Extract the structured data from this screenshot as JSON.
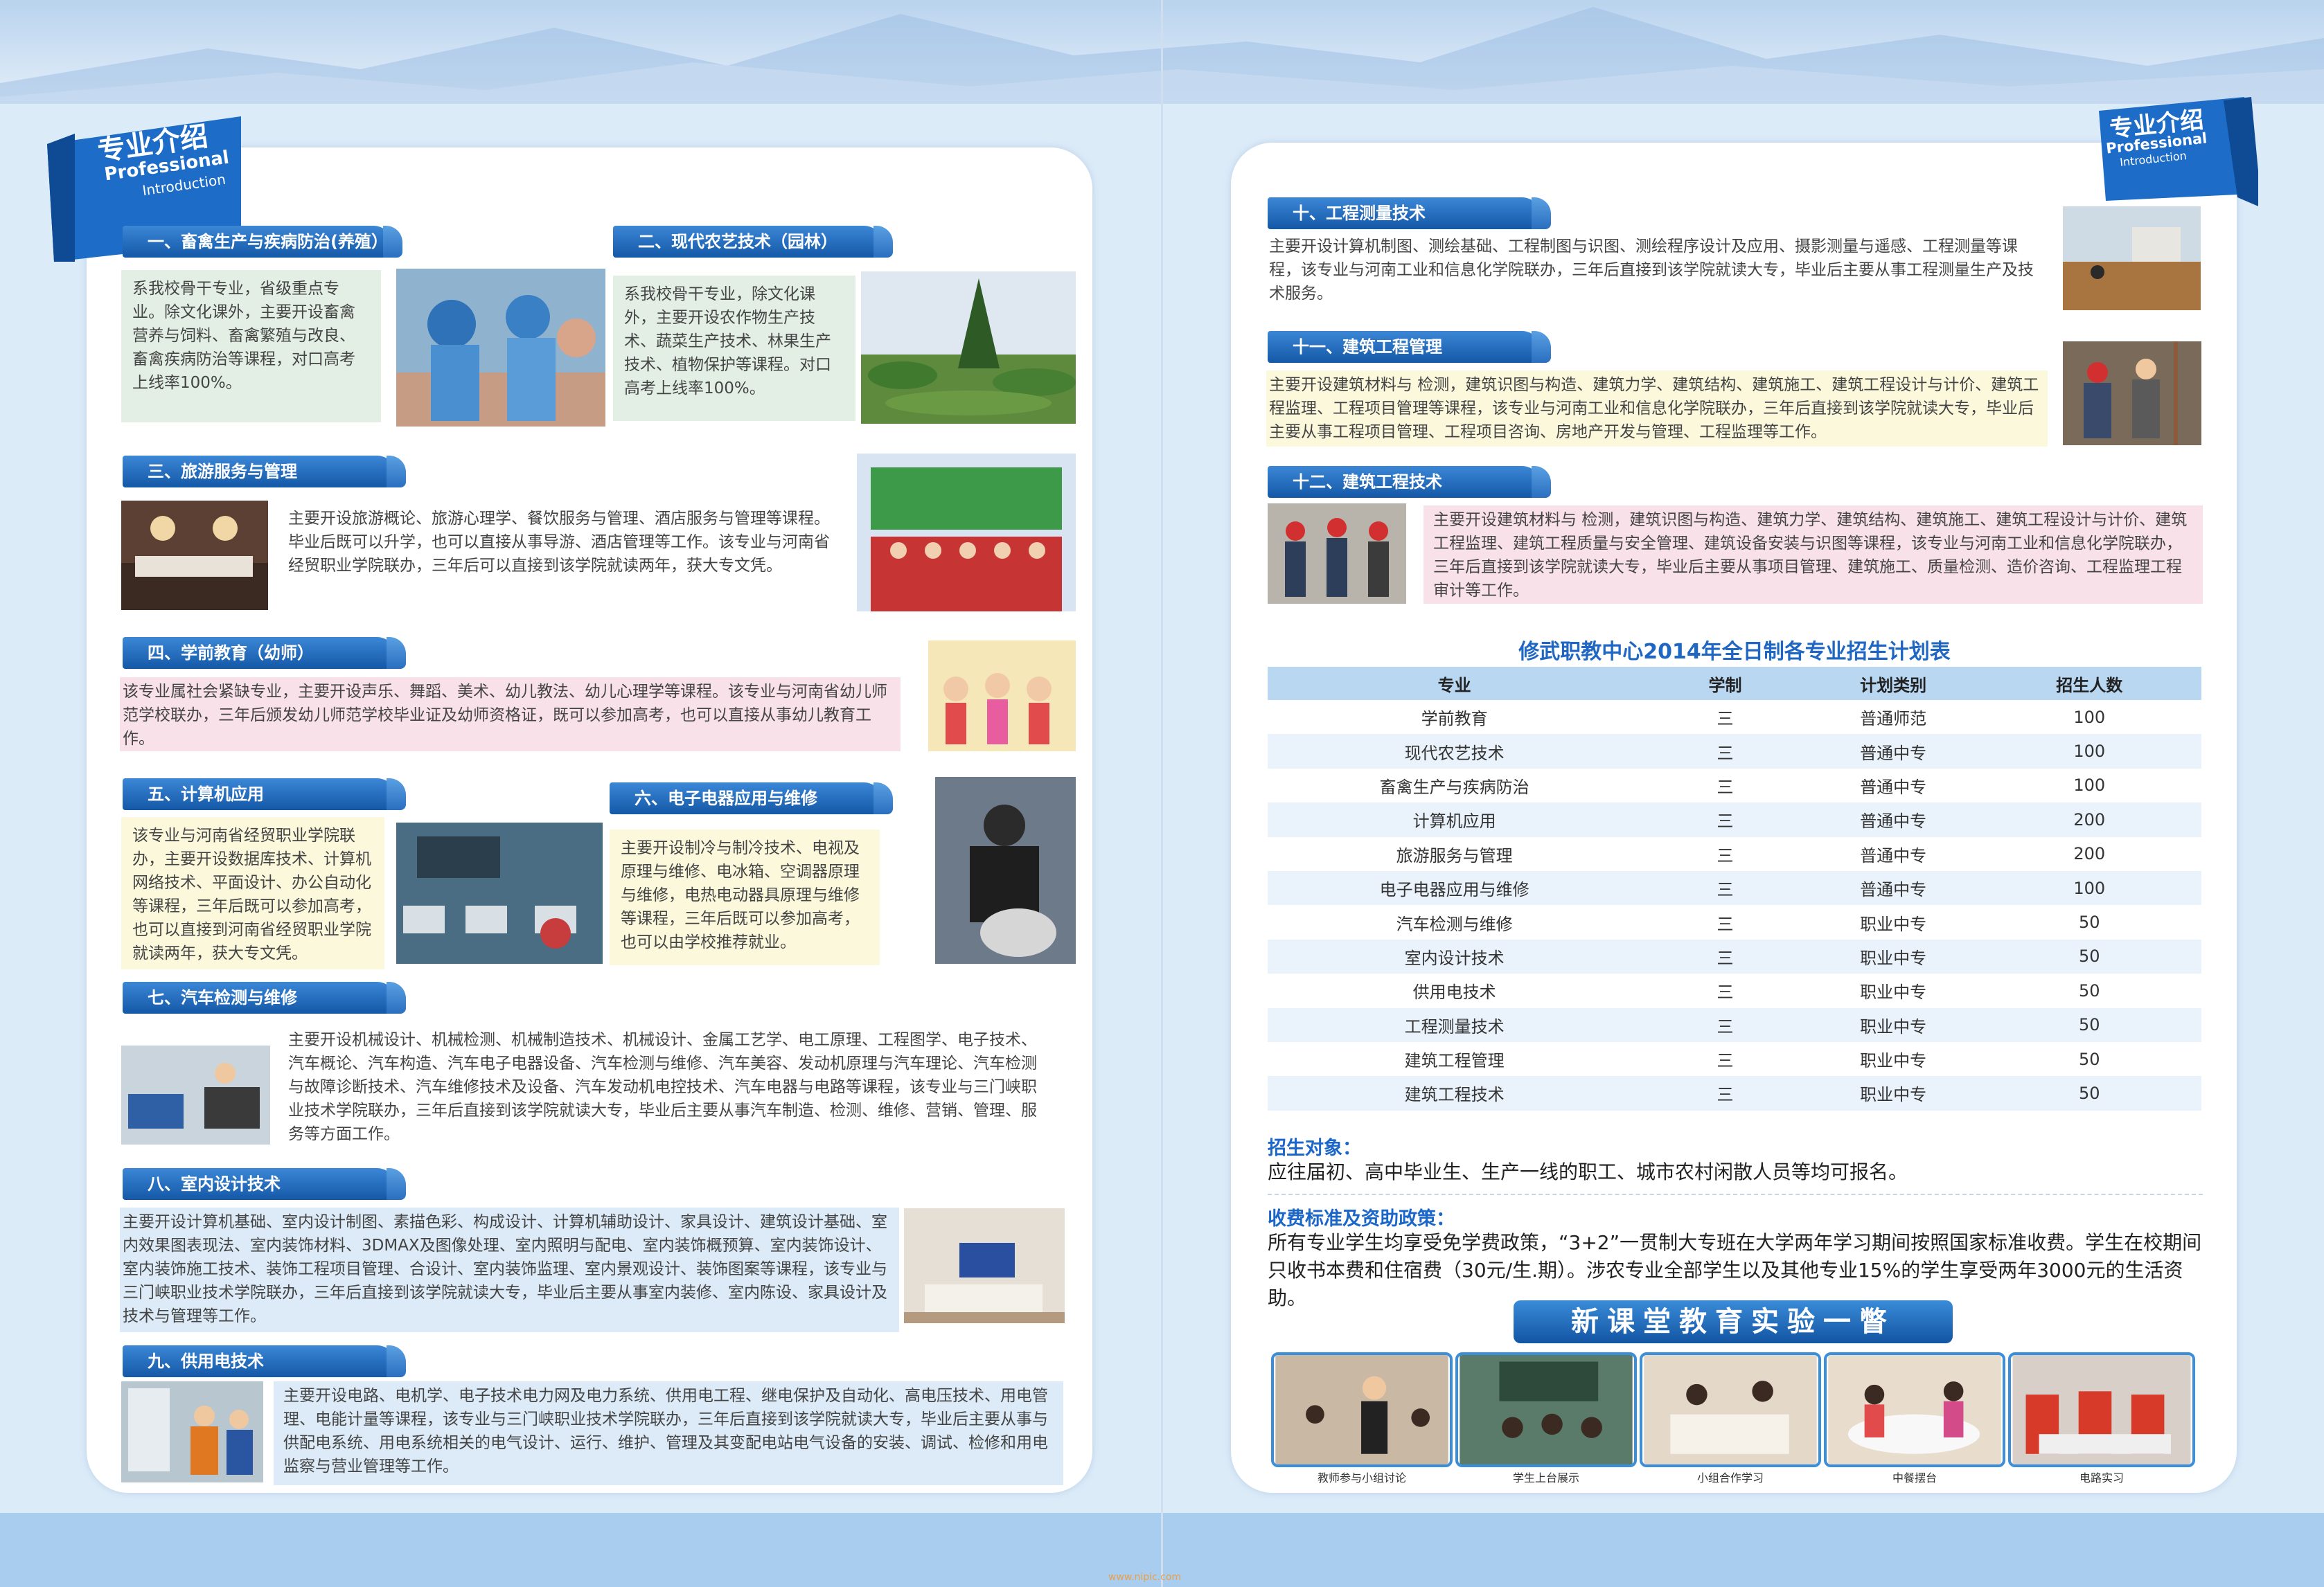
{
  "left_badge": {
    "title": "专业介绍",
    "en1": "Professional",
    "en2": "Introduction"
  },
  "right_badge": {
    "title": "专业介绍",
    "en1": "Professional",
    "en2": "Introduction"
  },
  "majors": [
    {
      "title": "一、畜禽生产与疾病防治(养殖）",
      "text": "系我校骨干专业，省级重点专业。除文化课外，主要开设畜禽营养与饲料、畜禽繁殖与改良、畜禽疾病防治等课程，对口高考上线率100%。"
    },
    {
      "title": "二、现代农艺技术（园林）",
      "text": "系我校骨干专业，除文化课外，主要开设农作物生产技术、蔬菜生产技术、林果生产技术、植物保护等课程。对口高考上线率100%。"
    },
    {
      "title": "三、旅游服务与管理",
      "text": "主要开设旅游概论、旅游心理学、餐饮服务与管理、酒店服务与管理等课程。毕业后既可以升学，也可以直接从事导游、酒店管理等工作。该专业与河南省经贸职业学院联办，三年后可以直接到该学院就读两年，获大专文凭。"
    },
    {
      "title": "四、学前教育（幼师）",
      "text": "该专业属社会紧缺专业，主要开设声乐、舞蹈、美术、幼儿教法、幼儿心理学等课程。该专业与河南省幼儿师范学校联办，三年后颁发幼儿师范学校毕业证及幼师资格证，既可以参加高考，也可以直接从事幼儿教育工作。"
    },
    {
      "title": "五、计算机应用",
      "text": "该专业与河南省经贸职业学院联办，主要开设数据库技术、计算机网络技术、平面设计、办公自动化等课程，三年后既可以参加高考，也可以直接到河南省经贸职业学院就读两年，获大专文凭。"
    },
    {
      "title": "六、电子电器应用与维修",
      "text": "主要开设制冷与制冷技术、电视及原理与维修、电冰箱、空调器原理与维修，电热电动器具原理与维修等课程，三年后既可以参加高考，也可以由学校推荐就业。"
    },
    {
      "title": "七、汽车检测与维修",
      "text": "主要开设机械设计、机械检测、机械制造技术、机械设计、金属工艺学、电工原理、工程图学、电子技术、汽车概论、汽车构造、汽车电子电器设备、汽车检测与维修、汽车美容、发动机原理与汽车理论、汽车检测与故障诊断技术、汽车维修技术及设备、汽车发动机电控技术、汽车电器与电路等课程，该专业与三门峡职业技术学院联办，三年后直接到该学院就读大专，毕业后主要从事汽车制造、检测、维修、营销、管理、服务等方面工作。"
    },
    {
      "title": "八、室内设计技术",
      "text": "主要开设计算机基础、室内设计制图、素描色彩、构成设计、计算机辅助设计、家具设计、建筑设计基础、室内效果图表现法、室内装饰材料、3DMAX及图像处理、室内照明与配电、室内装饰概预算、室内装饰设计、室内装饰施工技术、装饰工程项目管理、合设计、室内装饰监理、室内景观设计、装饰图案等课程，该专业与三门峡职业技术学院联办，三年后直接到该学院就读大专，毕业后主要从事室内装修、室内陈设、家具设计及技术与管理等工作。"
    },
    {
      "title": "九、供用电技术",
      "text": "主要开设电路、电机学、电子技术电力网及电力系统、供用电工程、继电保护及自动化、高电压技术、用电管理、电能计量等课程，该专业与三门峡职业技术学院联办，三年后直接到该学院就读大专，毕业后主要从事与供配电系统、用电系统相关的电气设计、运行、维护、管理及其变配电站电气设备的安装、调试、检修和用电监察与营业管理等工作。"
    },
    {
      "title": "十、工程测量技术",
      "text": "主要开设计算机制图、测绘基础、工程制图与识图、测绘程序设计及应用、摄影测量与遥感、工程测量等课程，该专业与河南工业和信息化学院联办，三年后直接到该学院就读大专，毕业后主要从事工程测量生产及技术服务。"
    },
    {
      "title": "十一、建筑工程管理",
      "text": "主要开设建筑材料与 检测，建筑识图与构造、建筑力学、建筑结构、建筑施工、建筑工程设计与计价、建筑工程监理、工程项目管理等课程，该专业与河南工业和信息化学院联办，三年后直接到该学院就读大专，毕业后主要从事工程项目管理、工程项目咨询、房地产开发与管理、工程监理等工作。"
    },
    {
      "title": "十二、建筑工程技术",
      "text": "主要开设建筑材料与 检测，建筑识图与构造、建筑力学、建筑结构、建筑施工、建筑工程设计与计价、建筑工程监理、建筑工程质量与安全管理、建筑设备安装与识图等课程，该专业与河南工业和信息化学院联办，三年后直接到该学院就读大专，毕业后主要从事项目管理、建筑施工、质量检测、造价咨询、工程监理工程审计等工作。"
    }
  ],
  "plan": {
    "title": "修武职教中心2014年全日制各专业招生计划表",
    "headers": [
      "专业",
      "学制",
      "计划类别",
      "招生人数"
    ],
    "rows": [
      [
        "学前教育",
        "三",
        "普通师范",
        "100"
      ],
      [
        "现代农艺技术",
        "三",
        "普通中专",
        "100"
      ],
      [
        "畜禽生产与疾病防治",
        "三",
        "普通中专",
        "100"
      ],
      [
        "计算机应用",
        "三",
        "普通中专",
        "200"
      ],
      [
        "旅游服务与管理",
        "三",
        "普通中专",
        "200"
      ],
      [
        "电子电器应用与维修",
        "三",
        "普通中专",
        "100"
      ],
      [
        "汽车检测与维修",
        "三",
        "职业中专",
        "50"
      ],
      [
        "室内设计技术",
        "三",
        "职业中专",
        "50"
      ],
      [
        "供用电技术",
        "三",
        "职业中专",
        "50"
      ],
      [
        "工程测量技术",
        "三",
        "职业中专",
        "50"
      ],
      [
        "建筑工程管理",
        "三",
        "职业中专",
        "50"
      ],
      [
        "建筑工程技术",
        "三",
        "职业中专",
        "50"
      ]
    ]
  },
  "enroll": {
    "label": "招生对象：",
    "text": "应往届初、高中毕业生、生产一线的职工、城市农村闲散人员等均可报名。"
  },
  "fees": {
    "label": "收费标准及资助政策：",
    "text": "所有专业学生均享受免学费政策，“3+2”一贯制大专班在大学两年学习期间按照国家标准收费。学生在校期间只收书本费和住宿费（30元/生.期）。涉农专业全部学生以及其他专业15%的学生享受两年3000元的生活资助。"
  },
  "gallery": {
    "banner": "新课堂教育实验一瞥",
    "captions": [
      "教师参与小组讨论",
      "学生上台展示",
      "小组合作学习",
      "中餐摆台",
      "电路实习"
    ]
  },
  "footer": "www.nipic.com",
  "colors": {
    "accent": "#1a66c9",
    "head": "#1458a8"
  }
}
